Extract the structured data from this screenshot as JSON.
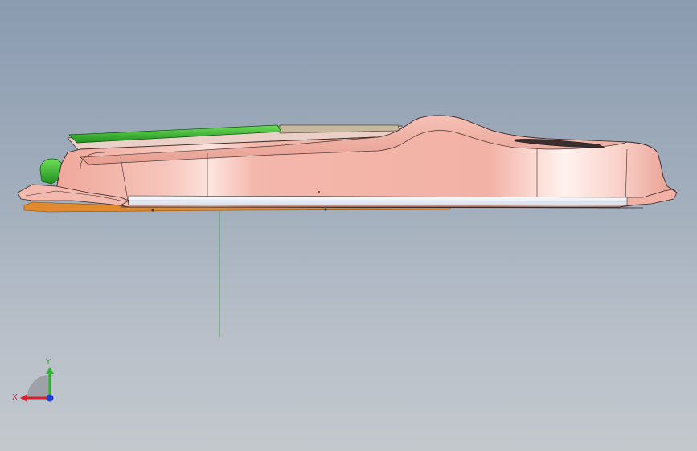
{
  "viewport": {
    "background_top": "#8a9bb0",
    "background_bottom": "#c3c8cd"
  },
  "model": {
    "body_color": "#f3b3a8",
    "highlight_color": "#fde6e1",
    "edge_color": "#3a2a28",
    "green_part_color": "#2fae2f",
    "orange_part_color": "#e0892e",
    "tan_part_color": "#c7b8a0",
    "datum_line_color": "#22c43a"
  },
  "triad": {
    "x_label": "X",
    "y_label": "Y",
    "x_color": "#d8202a",
    "y_color": "#2bb52b",
    "z_color": "#1f3fd6"
  }
}
